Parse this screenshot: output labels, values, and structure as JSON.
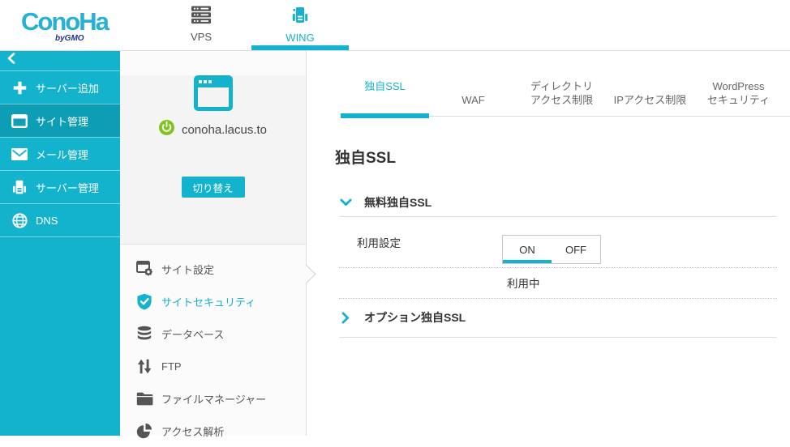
{
  "header": {
    "logo": {
      "text": "ConoHa",
      "sub": "byGMO"
    },
    "nav": [
      {
        "label": "VPS",
        "icon": "vps-servers-icon",
        "active": false
      },
      {
        "label": "WING",
        "icon": "wing-server-icon",
        "active": true
      }
    ]
  },
  "sidebar": {
    "back_icon": "chevron-left-icon",
    "items": [
      {
        "label": "サーバー追加",
        "icon": "plus-icon",
        "active": false
      },
      {
        "label": "サイト管理",
        "icon": "browser-window-icon",
        "active": true
      },
      {
        "label": "メール管理",
        "icon": "mail-icon",
        "active": false
      },
      {
        "label": "サーバー管理",
        "icon": "server-tower-icon",
        "active": false
      },
      {
        "label": "DNS",
        "icon": "globe-icon",
        "active": false
      }
    ]
  },
  "site_panel": {
    "site_icon": "browser-app-icon",
    "status_icon": "power-on-icon",
    "domain": "conoha.lacus.to",
    "switch_button": "切り替え",
    "menu": [
      {
        "label": "サイト設定",
        "icon": "site-settings-icon",
        "active": false
      },
      {
        "label": "サイトセキュリティ",
        "icon": "shield-check-icon",
        "active": true
      },
      {
        "label": "データベース",
        "icon": "database-icon",
        "active": false
      },
      {
        "label": "FTP",
        "icon": "up-down-arrows-icon",
        "active": false
      },
      {
        "label": "ファイルマネージャー",
        "icon": "folder-icon",
        "active": false
      },
      {
        "label": "アクセス解析",
        "icon": "pie-chart-icon",
        "active": false
      }
    ]
  },
  "main": {
    "tabs": [
      {
        "label": "独自SSL",
        "active": true
      },
      {
        "label": "WAF",
        "active": false
      },
      {
        "label": "ディレクトリ\nアクセス制限",
        "active": false
      },
      {
        "label": "IPアクセス制限",
        "active": false
      },
      {
        "label": "WordPress\nセキュリティ",
        "active": false
      }
    ],
    "title": "独自SSL",
    "free_section": {
      "title": "無料独自SSL",
      "expanded": true,
      "setting_label": "利用設定",
      "toggle": {
        "on_label": "ON",
        "off_label": "OFF",
        "selected": "ON"
      },
      "status_text": "利用中"
    },
    "option_section": {
      "title": "オプション独自SSL",
      "expanded": false
    }
  },
  "colors": {
    "brand_cyan": "#14b3cd",
    "sidebar_active": "#0d9db4",
    "logo_cyan": "#25b0d5",
    "logo_navy": "#223285",
    "power_green": "#82c41e",
    "divider_gray": "#dcdcdc",
    "card_gray": "#f4f4f4"
  }
}
